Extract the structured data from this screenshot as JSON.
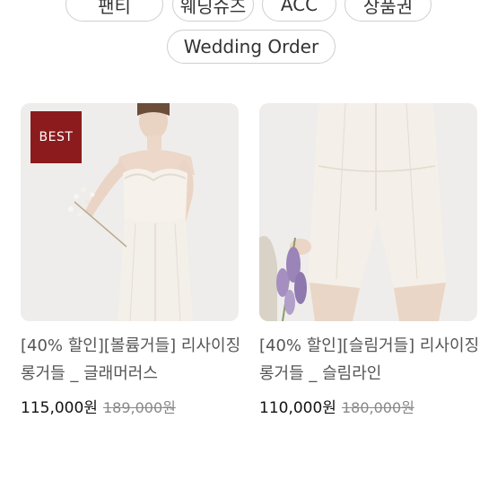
{
  "categories": {
    "chips": [
      "팬티",
      "웨딩슈즈",
      "ACC",
      "상품권"
    ],
    "wedding_order": "Wedding Order"
  },
  "products": [
    {
      "badge": "BEST",
      "title": "[40% 할인][볼륨거들] 리사이징 롱거들 _ 글래머러스",
      "price": "115,000원",
      "original_price": "189,000원"
    },
    {
      "title": "[40% 할인][슬림거들] 리사이징 롱거들 _ 슬림라인",
      "price": "110,000원",
      "original_price": "180,000원"
    }
  ],
  "colors": {
    "badge_bg": "#8b1b1d",
    "chip_border": "#cfcfcf",
    "title_text": "#555555"
  }
}
